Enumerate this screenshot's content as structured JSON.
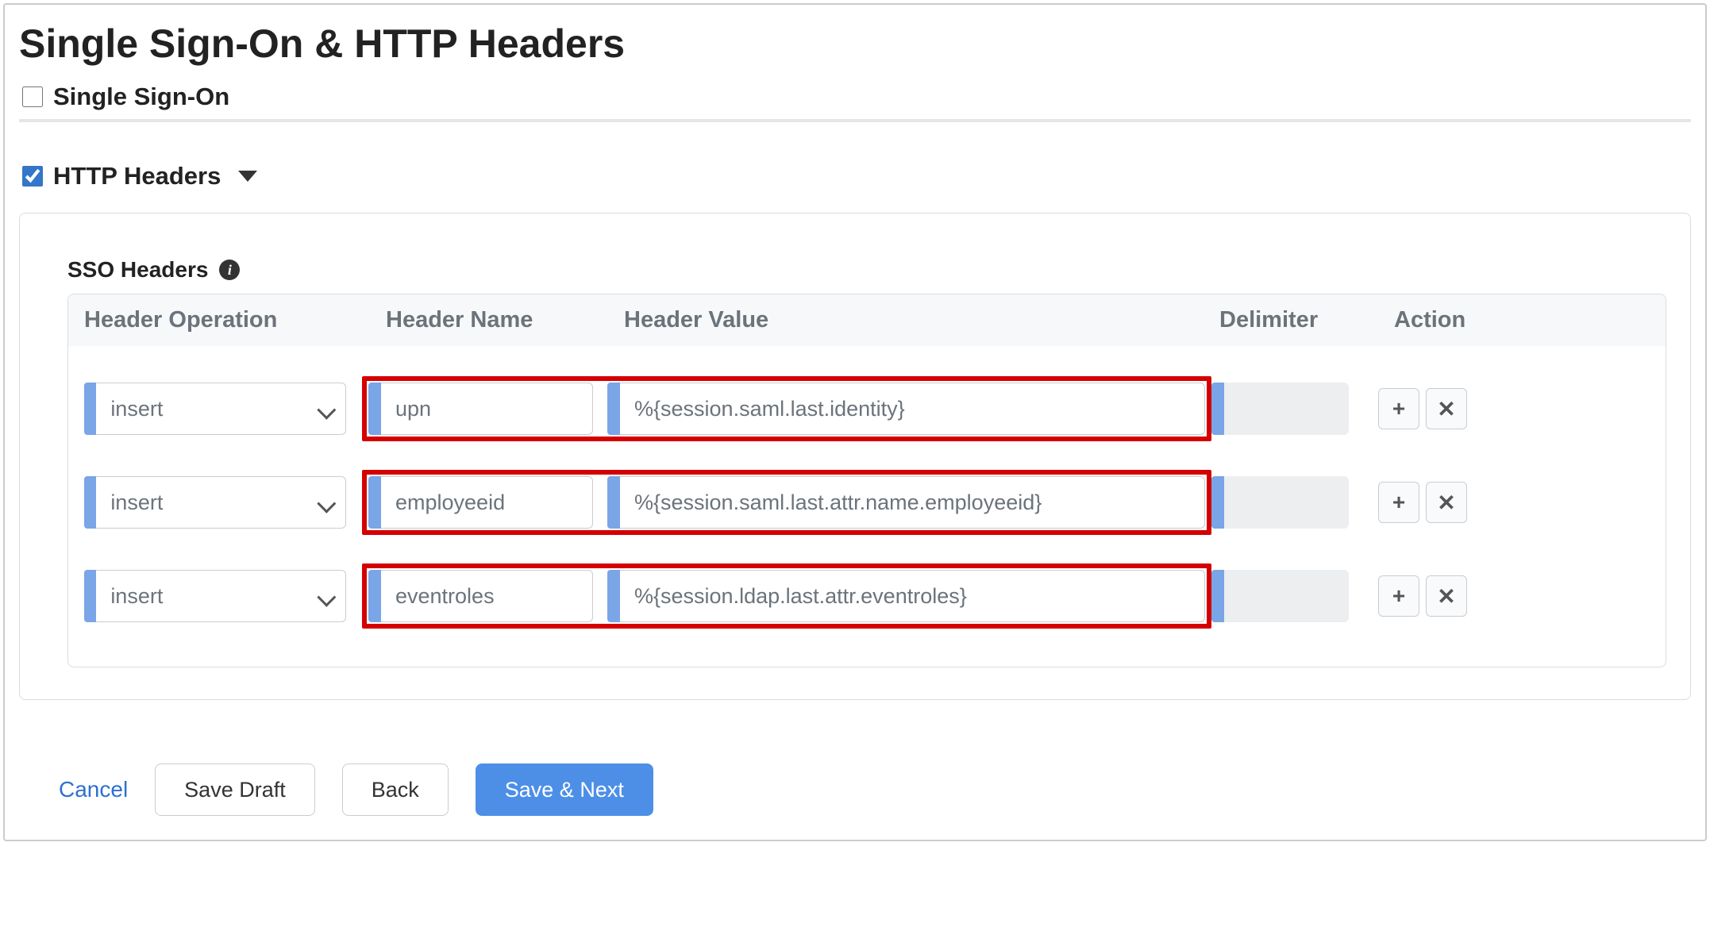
{
  "page": {
    "title": "Single Sign-On & HTTP Headers"
  },
  "sections": {
    "sso": {
      "label": "Single Sign-On",
      "checked": false
    },
    "http_headers": {
      "label": "HTTP Headers",
      "checked": true,
      "expanded": true
    }
  },
  "sso_headers": {
    "heading": "SSO Headers",
    "columns": {
      "operation": "Header Operation",
      "name": "Header Name",
      "value": "Header Value",
      "delimiter": "Delimiter",
      "action": "Action"
    },
    "rows": [
      {
        "operation": "insert",
        "name": "upn",
        "value": "%{session.saml.last.identity}",
        "delimiter": ""
      },
      {
        "operation": "insert",
        "name": "employeeid",
        "value": "%{session.saml.last.attr.name.employeeid}",
        "delimiter": ""
      },
      {
        "operation": "insert",
        "name": "eventroles",
        "value": "%{session.ldap.last.attr.eventroles}",
        "delimiter": ""
      }
    ]
  },
  "footer": {
    "cancel": "Cancel",
    "save_draft": "Save Draft",
    "back": "Back",
    "save_next": "Save & Next"
  },
  "icons": {
    "add": "+",
    "remove": "✕",
    "info": "i"
  }
}
